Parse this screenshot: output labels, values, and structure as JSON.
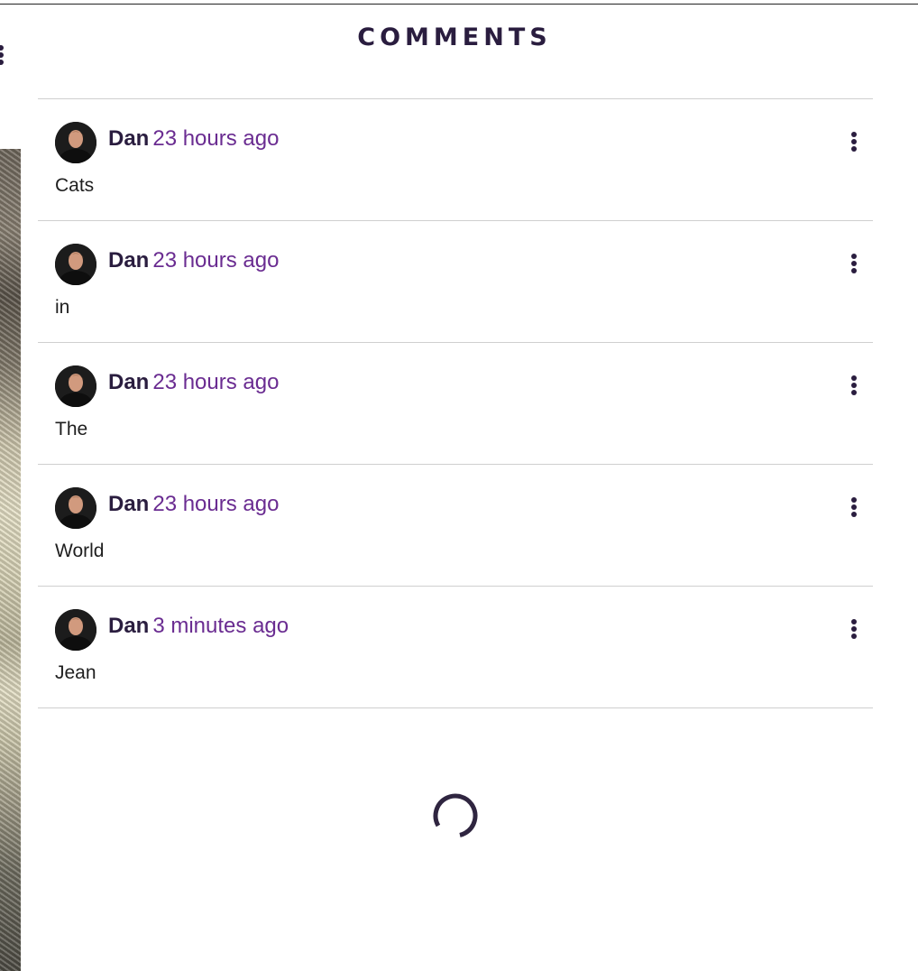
{
  "header": {
    "title": "COMMENTS"
  },
  "comments": [
    {
      "author": "Dan",
      "time": "23 hours ago",
      "text": "Cats"
    },
    {
      "author": "Dan",
      "time": "23 hours ago",
      "text": "in"
    },
    {
      "author": "Dan",
      "time": "23 hours ago",
      "text": "The"
    },
    {
      "author": "Dan",
      "time": "23 hours ago",
      "text": "World"
    },
    {
      "author": "Dan",
      "time": "3 minutes ago",
      "text": "Jean"
    }
  ],
  "icons": {
    "comment_menu": "more-vertical-icon",
    "loading": "spinner-icon",
    "avatar": "user-avatar"
  },
  "colors": {
    "title": "#2a1d3f",
    "author": "#2a1d3f",
    "timestamp": "#6a2c91",
    "divider": "#cfcfcf",
    "spinner": "#2f2540"
  }
}
